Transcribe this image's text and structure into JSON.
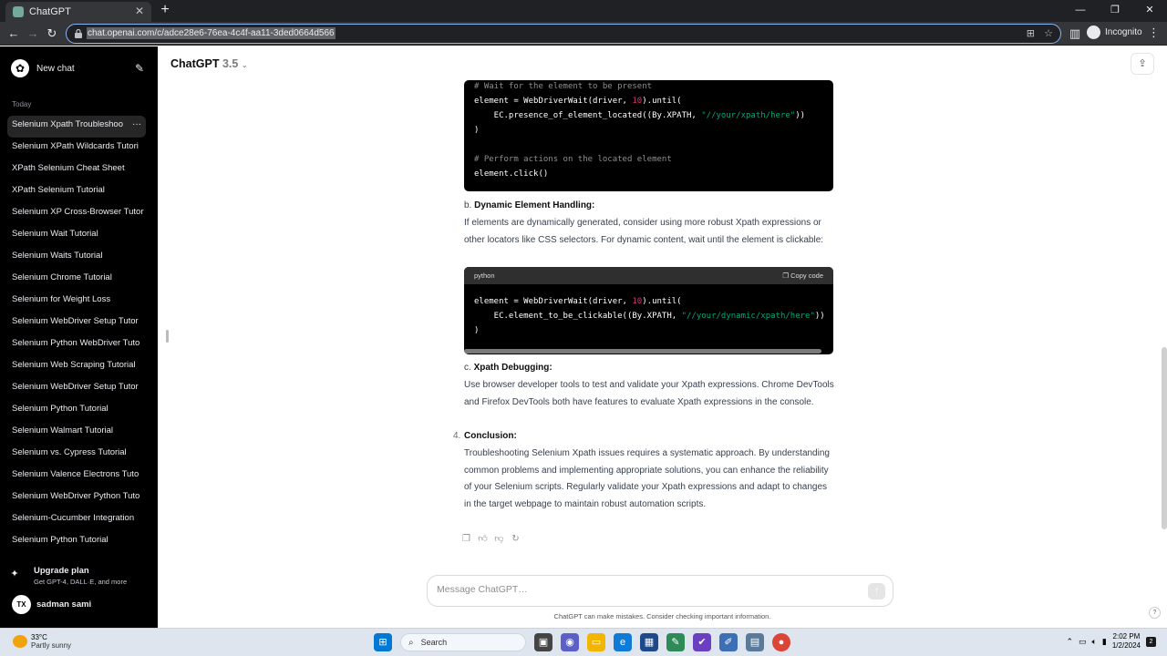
{
  "browser": {
    "tab_title": "ChatGPT",
    "tab_close": "✕",
    "new_tab": "+",
    "url": "chat.openai.com/c/adce28e6-76ea-4c4f-aa11-3ded0664d566",
    "profile_label": "Incognito",
    "window_controls": [
      "—",
      "❐",
      "✕"
    ]
  },
  "sidebar": {
    "new_chat_label": "New chat",
    "section_today": "Today",
    "items": [
      {
        "label": "Selenium Xpath Troubleshoo",
        "active": true
      },
      {
        "label": "Selenium XPath Wildcards Tutori"
      },
      {
        "label": "XPath Selenium Cheat Sheet"
      },
      {
        "label": "XPath Selenium Tutorial"
      },
      {
        "label": "Selenium XP Cross-Browser Tutor"
      },
      {
        "label": "Selenium Wait Tutorial"
      },
      {
        "label": "Selenium Waits Tutorial"
      },
      {
        "label": "Selenium Chrome Tutorial"
      },
      {
        "label": "Selenium for Weight Loss"
      },
      {
        "label": "Selenium WebDriver Setup Tutor"
      },
      {
        "label": "Selenium Python WebDriver Tuto"
      },
      {
        "label": "Selenium Web Scraping Tutorial"
      },
      {
        "label": "Selenium WebDriver Setup Tutor"
      },
      {
        "label": "Selenium Python Tutorial"
      },
      {
        "label": "Selenium Walmart Tutorial"
      },
      {
        "label": "Selenium vs. Cypress Tutorial"
      },
      {
        "label": "Selenium Valence Electrons Tuto"
      },
      {
        "label": "Selenium WebDriver Python Tuto"
      },
      {
        "label": "Selenium-Cucumber Integration"
      },
      {
        "label": "Selenium Python Tutorial"
      }
    ],
    "more_icon": "···",
    "upgrade_title": "Upgrade plan",
    "upgrade_sub": "Get GPT-4, DALL·E, and more",
    "user_initials": "TX",
    "user_name": "sadman sami"
  },
  "header": {
    "model_name": "ChatGPT",
    "model_version": "3.5"
  },
  "code1": {
    "lines": [
      {
        "parts": [
          {
            "t": "# Wait for the element to be present",
            "c": "cm"
          }
        ]
      },
      {
        "parts": [
          {
            "t": "element = WebDriverWait(driver, ",
            "c": ""
          },
          {
            "t": "10",
            "c": "nm"
          },
          {
            "t": ").until(",
            "c": ""
          }
        ]
      },
      {
        "parts": [
          {
            "t": "    EC.presence_of_element_located((By.XPATH, ",
            "c": ""
          },
          {
            "t": "\"//your/xpath/here\"",
            "c": "st"
          },
          {
            "t": "))",
            "c": ""
          }
        ]
      },
      {
        "parts": [
          {
            "t": ")",
            "c": ""
          }
        ]
      },
      {
        "parts": [
          {
            "t": "",
            "c": ""
          }
        ]
      },
      {
        "parts": [
          {
            "t": "# Perform actions on the located element",
            "c": "cm"
          }
        ]
      },
      {
        "parts": [
          {
            "t": "element.click()",
            "c": ""
          }
        ]
      }
    ]
  },
  "section_b": {
    "prefix": "b.",
    "heading": "Dynamic Element Handling:",
    "body": "If elements are dynamically generated, consider using more robust Xpath expressions or other locators like CSS selectors. For dynamic content, wait until the element is clickable:"
  },
  "code2": {
    "language": "python",
    "copy_label": "Copy code",
    "lines": [
      {
        "parts": [
          {
            "t": "element = WebDriverWait(driver, ",
            "c": ""
          },
          {
            "t": "10",
            "c": "nm"
          },
          {
            "t": ").until(",
            "c": ""
          }
        ]
      },
      {
        "parts": [
          {
            "t": "    EC.element_to_be_clickable((By.XPATH, ",
            "c": ""
          },
          {
            "t": "\"//your/dynamic/xpath/here\"",
            "c": "st"
          },
          {
            "t": "))",
            "c": ""
          }
        ]
      },
      {
        "parts": [
          {
            "t": ")",
            "c": ""
          }
        ]
      }
    ]
  },
  "section_c": {
    "prefix": "c.",
    "heading": "Xpath Debugging:",
    "body": "Use browser developer tools to test and validate your Xpath expressions. Chrome DevTools and Firefox DevTools both have features to evaluate Xpath expressions in the console."
  },
  "conclusion": {
    "number": "4.",
    "heading": "Conclusion:",
    "body": "Troubleshooting Selenium Xpath issues requires a systematic approach. By understanding common problems and implementing appropriate solutions, you can enhance the reliability of your Selenium scripts. Regularly validate your Xpath expressions and adapt to changes in the target webpage to maintain robust automation scripts."
  },
  "composer": {
    "placeholder": "Message ChatGPT…",
    "disclaimer": "ChatGPT can make mistakes. Consider checking important information.",
    "help": "?"
  },
  "taskbar": {
    "temperature": "33°C",
    "weather": "Partly sunny",
    "search_label": "Search",
    "time": "2:02 PM",
    "date": "1/2/2024",
    "notification_count": "2"
  }
}
